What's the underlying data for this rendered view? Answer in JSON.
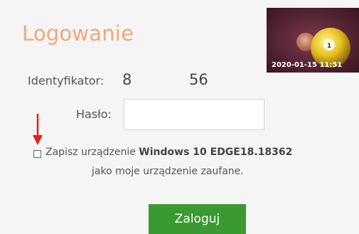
{
  "login": {
    "title": "Logowanie",
    "identifier_label": "Identyfikator:",
    "identifier_value_start": "8",
    "identifier_value_end": "56",
    "password_label": "Hasło:",
    "password_value": "",
    "remember_prefix": "Zapisz urządzenie ",
    "remember_device": "Windows 10 EDGE18.18362",
    "remember_suffix": "jako moje urządzenie zaufane.",
    "remember_checked": false,
    "submit_label": "Zaloguj"
  },
  "thumbnail": {
    "timestamp": "2020-01-15 11:51"
  },
  "colors": {
    "title": "#f0a878",
    "button": "#3a9a32",
    "arrow": "#e02020"
  },
  "icons": {
    "annotation_arrow": "arrow-down-icon"
  }
}
